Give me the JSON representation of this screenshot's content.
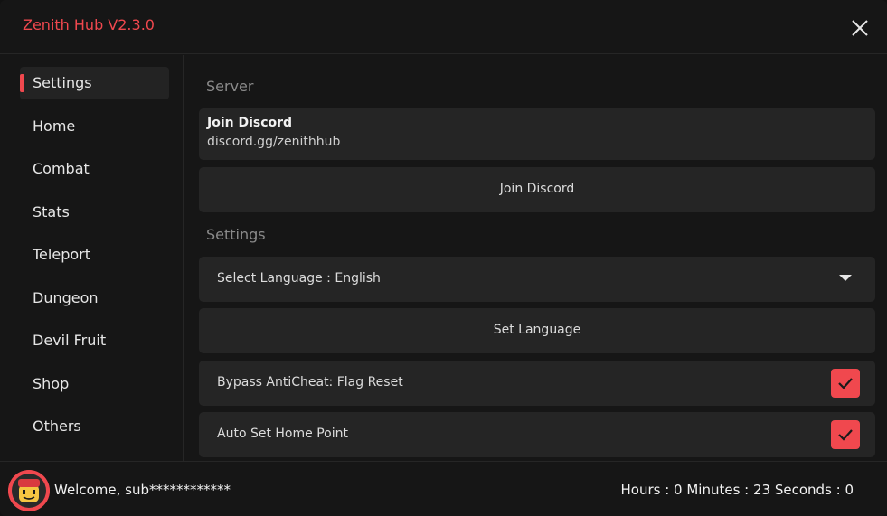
{
  "app": {
    "title": "Zenith Hub V2.3.0"
  },
  "sidebar": {
    "items": [
      {
        "label": "Settings",
        "active": true
      },
      {
        "label": "Home"
      },
      {
        "label": "Combat"
      },
      {
        "label": "Stats"
      },
      {
        "label": "Teleport"
      },
      {
        "label": "Dungeon"
      },
      {
        "label": "Devil Fruit"
      },
      {
        "label": "Shop"
      },
      {
        "label": "Others"
      }
    ]
  },
  "main": {
    "server_section": "Server",
    "discord_card": {
      "title": "Join Discord",
      "subtitle": "discord.gg/zenithhub"
    },
    "join_discord_button": "Join Discord",
    "settings_section": "Settings",
    "language_dropdown": {
      "label": "Select Language : English"
    },
    "set_language_button": "Set Language",
    "toggles": [
      {
        "label": "Bypass AntiCheat: Flag Reset",
        "checked": true
      },
      {
        "label": "Auto Set Home Point",
        "checked": true
      }
    ]
  },
  "footer": {
    "welcome": "Welcome, sub************",
    "timer": "Hours : 0 Minutes : 23 Seconds : 0"
  },
  "colors": {
    "accent": "#f0484e",
    "background": "#161616",
    "card": "#252525"
  },
  "icons": {
    "close": "close-icon",
    "dropdown": "chevron-down-icon",
    "check": "check-icon",
    "avatar": "avatar"
  }
}
